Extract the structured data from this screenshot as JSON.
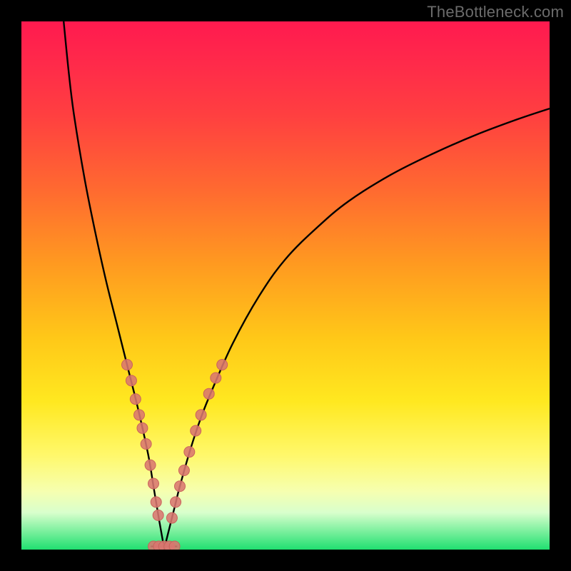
{
  "watermark": {
    "text": "TheBottleneck.com"
  },
  "colors": {
    "curve_stroke": "#000000",
    "marker_fill": "#d9766f",
    "marker_stroke": "#c9635c",
    "frame": "#000000"
  },
  "chart_data": {
    "type": "line",
    "title": "",
    "xlabel": "",
    "ylabel": "",
    "xlim": [
      0,
      100
    ],
    "ylim": [
      0,
      100
    ],
    "x_min_curve": 27,
    "series": [
      {
        "name": "left-branch",
        "x": [
          8,
          9,
          10,
          12,
          14,
          16,
          18,
          20,
          22,
          24,
          25,
          26,
          26.8,
          27
        ],
        "y": [
          100,
          90,
          82,
          70,
          60,
          51,
          43,
          35,
          27,
          18,
          12,
          6,
          1.5,
          0
        ]
      },
      {
        "name": "right-branch",
        "x": [
          27,
          28,
          29,
          30,
          32,
          34,
          36,
          40,
          45,
          50,
          56,
          62,
          70,
          78,
          86,
          94,
          100
        ],
        "y": [
          0,
          4,
          8,
          12,
          19,
          25,
          30,
          39,
          48,
          55,
          61,
          66,
          71,
          75,
          78.5,
          81.5,
          83.5
        ]
      }
    ],
    "flat_bottom": {
      "x0": 24.5,
      "x1": 29.5,
      "y": 0.6
    },
    "markers_left": [
      {
        "x": 20.0,
        "y": 35.0
      },
      {
        "x": 20.8,
        "y": 32.0
      },
      {
        "x": 21.6,
        "y": 28.5
      },
      {
        "x": 22.3,
        "y": 25.5
      },
      {
        "x": 22.9,
        "y": 23.0
      },
      {
        "x": 23.6,
        "y": 20.0
      },
      {
        "x": 24.4,
        "y": 16.0
      },
      {
        "x": 25.0,
        "y": 12.5
      },
      {
        "x": 25.5,
        "y": 9.0
      },
      {
        "x": 25.9,
        "y": 6.5
      }
    ],
    "markers_right": [
      {
        "x": 28.5,
        "y": 6.0
      },
      {
        "x": 29.2,
        "y": 9.0
      },
      {
        "x": 30.0,
        "y": 12.0
      },
      {
        "x": 30.8,
        "y": 15.0
      },
      {
        "x": 31.8,
        "y": 18.5
      },
      {
        "x": 33.0,
        "y": 22.5
      },
      {
        "x": 34.0,
        "y": 25.5
      },
      {
        "x": 35.5,
        "y": 29.5
      },
      {
        "x": 36.8,
        "y": 32.5
      },
      {
        "x": 38.0,
        "y": 35.0
      }
    ],
    "markers_bottom": [
      {
        "x": 25.0,
        "y": 0.6
      },
      {
        "x": 26.0,
        "y": 0.6
      },
      {
        "x": 27.0,
        "y": 0.6
      },
      {
        "x": 28.0,
        "y": 0.6
      },
      {
        "x": 29.0,
        "y": 0.6
      }
    ]
  }
}
